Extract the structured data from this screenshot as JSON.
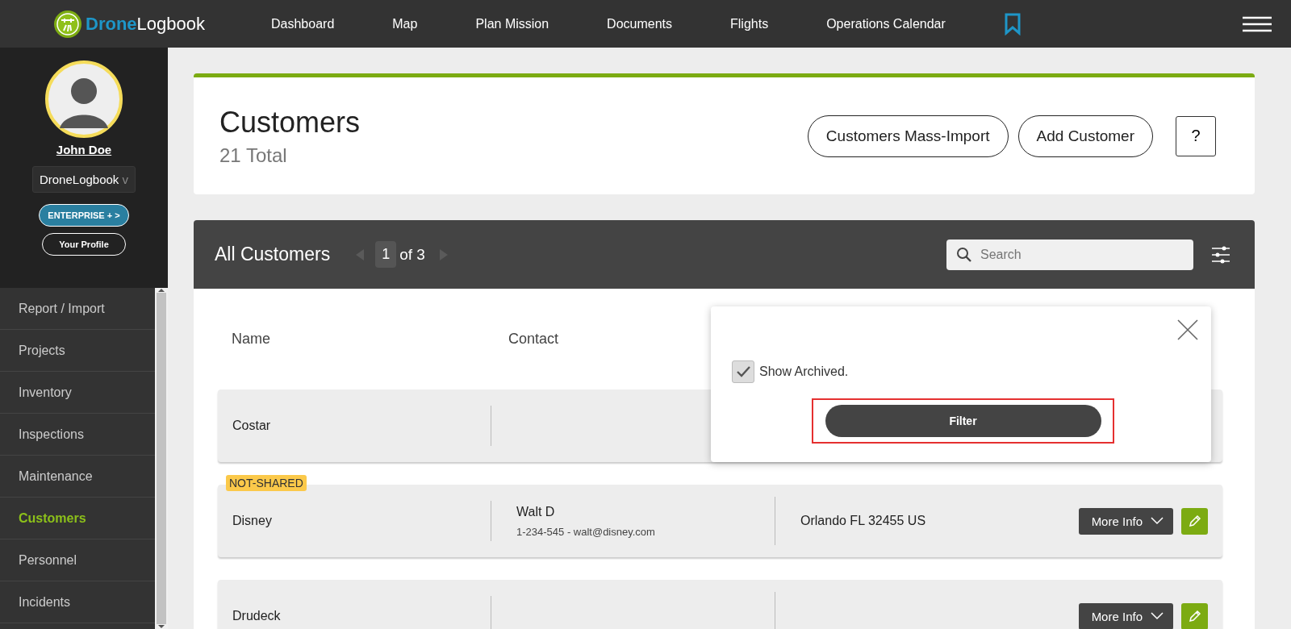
{
  "header": {
    "logo": {
      "part1": "Drone",
      "part2": "Logbook"
    },
    "nav": [
      "Dashboard",
      "Map",
      "Plan Mission",
      "Documents",
      "Flights",
      "Operations Calendar"
    ]
  },
  "profile": {
    "name": "John Doe",
    "org": "DroneLogbook",
    "org_caret": "v",
    "plan": "ENTERPRISE + >",
    "profile_button": "Your Profile"
  },
  "sidebar": {
    "items": [
      {
        "label": "Report / Import",
        "selected": false
      },
      {
        "label": "Projects",
        "selected": false
      },
      {
        "label": "Inventory",
        "selected": false
      },
      {
        "label": "Inspections",
        "selected": false
      },
      {
        "label": "Maintenance",
        "selected": false
      },
      {
        "label": "Customers",
        "selected": true
      },
      {
        "label": "Personnel",
        "selected": false
      },
      {
        "label": "Incidents",
        "selected": false
      }
    ]
  },
  "page": {
    "title": "Customers",
    "total": "21 Total",
    "buttons": [
      "Customers Mass-Import",
      "Add Customer"
    ],
    "help": "?"
  },
  "list": {
    "title": "All Customers",
    "page": "1",
    "of": "of 3",
    "search": {
      "placeholder": "Search"
    },
    "columns": [
      "Name",
      "Contact"
    ],
    "rows": [
      {
        "name": "Costar"
      },
      {
        "name": "Disney",
        "badge": "NOT-SHARED",
        "contact_name": "Walt D",
        "contact_detail": "1-234-545 - walt@disney.com",
        "address": "Orlando FL 32455 US",
        "more": "More Info"
      },
      {
        "name": "Drudeck",
        "more": "More Info"
      }
    ]
  },
  "filter_popup": {
    "checkbox": {
      "label": "Show Archived.",
      "checked": true
    },
    "button": {
      "label": "Filter",
      "highlighted": true
    }
  }
}
